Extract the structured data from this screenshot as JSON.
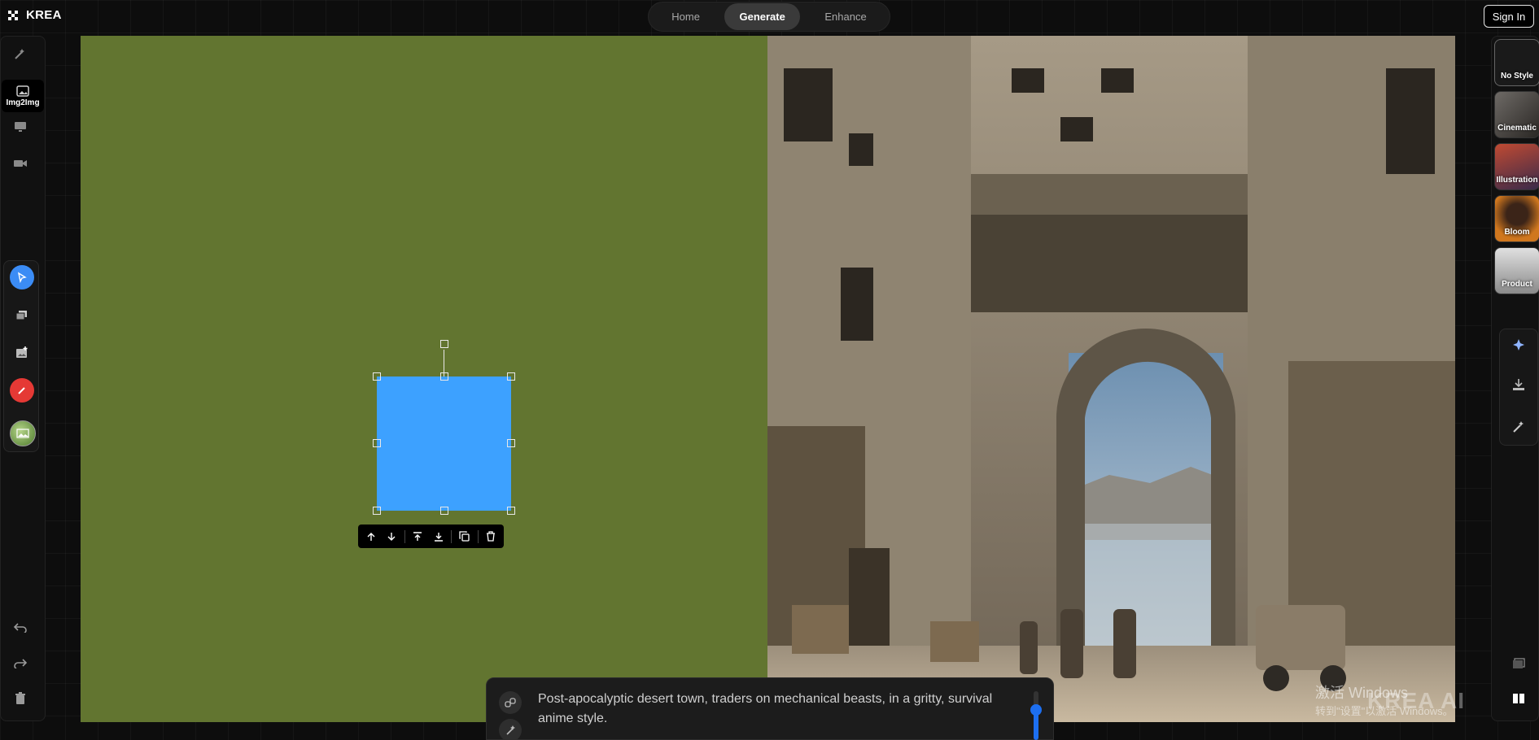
{
  "app": {
    "name": "KREA"
  },
  "nav": {
    "tabs": [
      {
        "label": "Home"
      },
      {
        "label": "Generate"
      },
      {
        "label": "Enhance"
      }
    ],
    "active": "Generate"
  },
  "auth": {
    "sign_in_label": "Sign In"
  },
  "left_sidebar": {
    "modes": [
      {
        "icon": "wand-icon",
        "label": ""
      },
      {
        "icon": "image-icon",
        "label": "Img2Img"
      },
      {
        "icon": "monitor-icon",
        "label": ""
      },
      {
        "icon": "video-camera-icon",
        "label": ""
      }
    ],
    "tools": [
      {
        "icon": "pointer-icon",
        "color": "#3b8cf5"
      },
      {
        "icon": "layers-icon"
      },
      {
        "icon": "add-image-icon"
      },
      {
        "icon": "brush-icon",
        "color": "#e53935"
      },
      {
        "icon": "landscape-thumbnail-icon"
      }
    ],
    "bottom_actions": [
      {
        "icon": "undo-icon"
      },
      {
        "icon": "redo-icon"
      },
      {
        "icon": "trash-icon"
      }
    ]
  },
  "canvas": {
    "background_color": "#627530",
    "shape_color": "#3da1ff",
    "shape_toolbar": [
      {
        "icon": "move-up-icon"
      },
      {
        "icon": "move-down-icon"
      },
      {
        "icon": "bring-to-front-icon"
      },
      {
        "icon": "send-to-back-icon"
      },
      {
        "icon": "duplicate-icon"
      },
      {
        "icon": "delete-icon"
      }
    ]
  },
  "right_sidebar": {
    "styles": [
      {
        "label": "No Style"
      },
      {
        "label": "Cinematic"
      },
      {
        "label": "Illustration"
      },
      {
        "label": "Bloom"
      },
      {
        "label": "Product"
      }
    ],
    "actions": [
      {
        "icon": "sparkles-icon"
      },
      {
        "icon": "download-icon"
      },
      {
        "icon": "enhance-wand-icon"
      }
    ],
    "bottom": [
      {
        "icon": "single-view-icon"
      },
      {
        "icon": "split-view-icon"
      }
    ]
  },
  "prompt": {
    "text_line1": "Post-apocalyptic desert town, traders on mechanical beasts, in a gritty, survival",
    "text_line2": "anime style.",
    "slider_level": 0.6
  },
  "watermarks": {
    "krea": "KREA AI",
    "windows_line1": "激活 Windows",
    "windows_line2": "转到\"设置\"以激活 Windows。"
  }
}
